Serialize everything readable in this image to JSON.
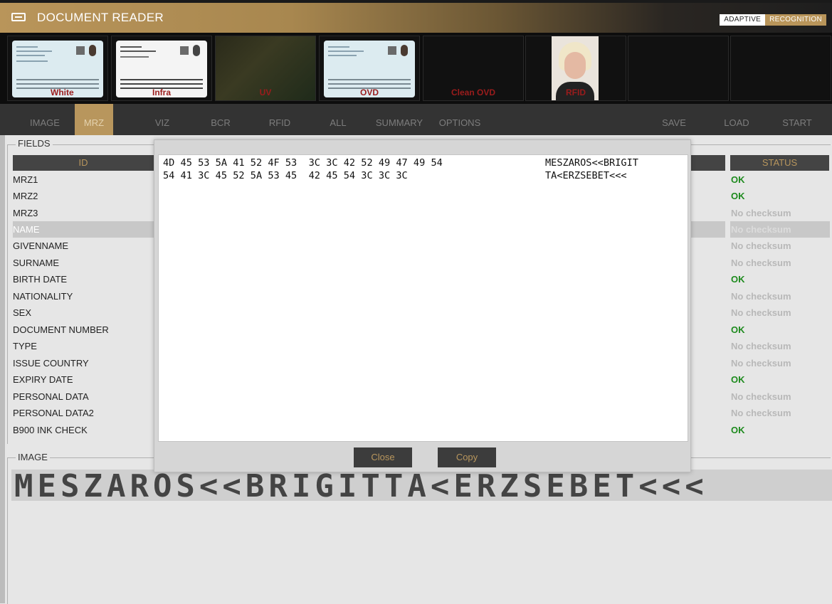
{
  "app": {
    "title": "DOCUMENT READER",
    "brand_left": "ADAPTIVE",
    "brand_right": "RECOGNITION"
  },
  "thumbnails": [
    {
      "label": "White",
      "kind": "card-light"
    },
    {
      "label": "Infra",
      "kind": "card-gray"
    },
    {
      "label": "UV",
      "kind": "card-dark"
    },
    {
      "label": "OVD",
      "kind": "card-light"
    },
    {
      "label": "Clean OVD",
      "kind": "empty"
    },
    {
      "label": "RFID",
      "kind": "photo"
    },
    {
      "label": "",
      "kind": "empty"
    },
    {
      "label": "",
      "kind": "empty"
    }
  ],
  "nav": {
    "items": [
      "IMAGE",
      "MRZ",
      "VIZ",
      "BCR",
      "RFID",
      "ALL",
      "SUMMARY",
      "OPTIONS"
    ],
    "active": "MRZ",
    "right_items": [
      "SAVE",
      "LOAD",
      "START"
    ]
  },
  "fields": {
    "legend": "FIELDS",
    "col_id": "ID",
    "col_status": "STATUS",
    "rows": [
      {
        "id": "MRZ1",
        "status": "OK"
      },
      {
        "id": "MRZ2",
        "status": "OK"
      },
      {
        "id": "MRZ3",
        "status": "No checksum"
      },
      {
        "id": "NAME",
        "status": "No checksum",
        "selected": true
      },
      {
        "id": "GIVENNAME",
        "status": "No checksum"
      },
      {
        "id": "SURNAME",
        "status": "No checksum"
      },
      {
        "id": "BIRTH DATE",
        "status": "OK"
      },
      {
        "id": "NATIONALITY",
        "status": "No checksum"
      },
      {
        "id": "SEX",
        "status": "No checksum"
      },
      {
        "id": "DOCUMENT NUMBER",
        "status": "OK"
      },
      {
        "id": "TYPE",
        "status": "No checksum"
      },
      {
        "id": "ISSUE COUNTRY",
        "status": "No checksum"
      },
      {
        "id": "EXPIRY DATE",
        "status": "OK"
      },
      {
        "id": "PERSONAL DATA",
        "status": "No checksum"
      },
      {
        "id": "PERSONAL DATA2",
        "status": "No checksum"
      },
      {
        "id": "B900 INK CHECK",
        "status": "OK"
      }
    ]
  },
  "image_section": {
    "legend": "IMAGE",
    "mrz_text": "MESZAROS<<BRIGITTA<ERZSEBET<<<"
  },
  "modal": {
    "hex_lines": [
      "4D 45 53 5A 41 52 4F 53  3C 3C 42 52 49 47 49 54",
      "54 41 3C 45 52 5A 53 45  42 45 54 3C 3C 3C"
    ],
    "ascii_lines": [
      "MESZAROS<<BRIGIT",
      "TA<ERZSEBET<<<"
    ],
    "close_label": "Close",
    "copy_label": "Copy"
  },
  "colors": {
    "accent": "#b8965d",
    "ok": "#1d8a1d",
    "muted": "#b8b8b8",
    "thumb_label": "#9b1c1c"
  }
}
